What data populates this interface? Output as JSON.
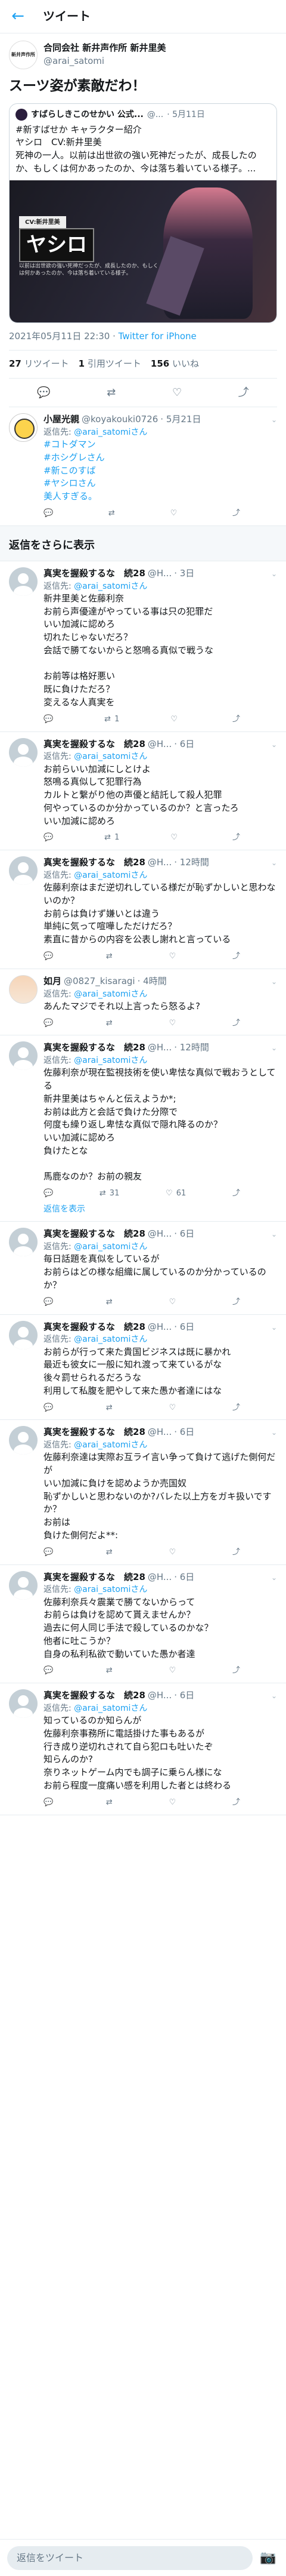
{
  "header": {
    "title": "ツイート"
  },
  "main": {
    "author_name": "合同会社 新井声作所 新井里美",
    "author_handle": "@arai_satomi",
    "avatar_text": "新井声作所",
    "text": "スーツ姿が素敵だわ！",
    "quote": {
      "name": "すばらしきこのせかい 公式...",
      "handle": "@...",
      "date": "· 5月11日",
      "text": "#新すばせか キャラクター紹介\nヤシロ　CV:新井里美\n死神の一人。以前は出世欲の強い死神だったが、成長したのか、もしくは何かあったのか、今は落ち着いている様子。...",
      "img_plate": "CV:新井里美",
      "img_name": "ヤシロ",
      "img_desc": "以前は出世欲の強い死神だったが、成長したのか、もしくは何かあったのか、今は落ち着いている様子。"
    },
    "time": "2021年05月11日 22:30 ·",
    "via": "Twitter for iPhone",
    "retweets": "27",
    "retweets_label": "リツイート",
    "quotes": "1",
    "quotes_label": "引用ツイート",
    "likes": "156",
    "likes_label": "いいね"
  },
  "reply_label": "返信先:",
  "reply_target": "@arai_satomiさん",
  "more_replies_label": "返信をさらに表示",
  "show_more_label": "返信を表示",
  "replies": [
    {
      "name": "小屋光親",
      "handle": "@koyakouki0726",
      "date": "· 5月21日",
      "body": "#コトダマン\n#ホシグレさん\n#新このすば\n#ヤシロさん\n美人すぎる。",
      "reply_count": "",
      "rt": "",
      "like": ""
    },
    {
      "name": "真実を握殺するな　続28",
      "handle": "@H...",
      "date": "· 3日",
      "body": "新井里美と佐藤利奈\nお前ら声優達がやっている事は只の犯罪だ\nいい加減に認めろ\n切れたじゃないだろ？\n会話で勝てないからと怒鳴る真似で戦うな\n\nお前等は格好悪い\n既に負けただろ？\n変えるな人真実を",
      "reply_count": "",
      "rt": "1",
      "like": ""
    },
    {
      "name": "真実を握殺するな　続28",
      "handle": "@H...",
      "date": "· 6日",
      "body": "お前らいい加減にしとけよ\n怒鳴る真似して犯罪行為\nカルトと繋がり他の声優と結託して殺人犯罪\n何やっているのか分かっているのか？と言ったろ\nいい加減に認めろ",
      "reply_count": "",
      "rt": "1",
      "like": ""
    },
    {
      "name": "真実を握殺するな　続28",
      "handle": "@H...",
      "date": "· 12時間",
      "body": "佐藤利奈はまだ逆切れしている様だが恥ずかしいと思わないのか？\nお前らは負けず嫌いとは違う\n単純に気って喧嘩しただけだろ？\n素直に昔からの内容を公表し謝れと言っている",
      "reply_count": "",
      "rt": "",
      "like": ""
    },
    {
      "name": "如月",
      "handle": "@0827_kisaragi",
      "date": "· 4時間",
      "body": "あんたマジでそれ以上言ったら怒るよ?",
      "reply_count": "",
      "rt": "",
      "like": ""
    },
    {
      "name": "真実を握殺するな　続28",
      "handle": "@H...",
      "date": "· 12時間",
      "body": "佐藤利奈が現在監視技術を使い卑怯な真似で戦おうとしてる\n新井里美はちゃんと伝えようか*;\nお前は此方と会話で負けた分際で\n何度も繰り返し卑怯な真似で隠れ降るのか？\nいい加減に認めろ\n負けたとな\n\n馬鹿なのか？お前の親友",
      "reply_count": "",
      "rt": "31",
      "like": "61",
      "has_show_more": true
    },
    {
      "name": "真実を握殺するな　続28",
      "handle": "@H...",
      "date": "· 6日",
      "body": "毎日話題を真似をしているが\nお前らはどの様な組織に属しているのか分かっているのか？",
      "reply_count": "",
      "rt": "",
      "like": ""
    },
    {
      "name": "真実を握殺するな　続28",
      "handle": "@H...",
      "date": "· 6日",
      "body": "お前らが行って来た貴国ビジネスは既に暴かれ\n最近も彼女に一般に知れ渡って来ているがな\n後々罰せられるだろうな\n利用して私腹を肥やして来た愚か者達にはな",
      "reply_count": "",
      "rt": "",
      "like": ""
    },
    {
      "name": "真実を握殺するな　続28",
      "handle": "@H...",
      "date": "· 6日",
      "body": "佐藤利奈達は実際お互ライ言い争って負けて逃げた側何だが\nいい加減に負けを認めようか売国奴\n恥ずかしいと思わないのか?バレた以上方をガキ扱いですか？\nお前は\n負けた側何だよ**:",
      "reply_count": "",
      "rt": "",
      "like": ""
    },
    {
      "name": "真実を握殺するな　続28",
      "handle": "@H...",
      "date": "· 6日",
      "body": "佐藤利奈兵々震業で勝てないからって\nお前らは負けを認めて貰えませんか？\n過去に何人同じ手法で殺しているのかな？\n他者に吐こうか？\n自身の私利私欲で動いていた愚か者達",
      "reply_count": "",
      "rt": "",
      "like": ""
    },
    {
      "name": "真実を握殺するな　続28",
      "handle": "@H...",
      "date": "· 6日",
      "body": "知っているのか知らんが\n佐藤利奈事務所に電話掛けた事もあるが\n行き成り逆切れされて自ら犯ロも吐いたぞ\n知らんのか?\n奈りネットゲーム内でも調子に乗らん様にな\nお前ら程度一度痛い感を利用した者とは終わる",
      "reply_count": "",
      "rt": "",
      "like": ""
    }
  ],
  "bottom": {
    "placeholder": "返信をツイート"
  },
  "icons": [
    "back-arrow-icon",
    "reply-icon",
    "retweet-icon",
    "like-icon",
    "share-icon",
    "camera-icon",
    "chevron-down-icon"
  ]
}
